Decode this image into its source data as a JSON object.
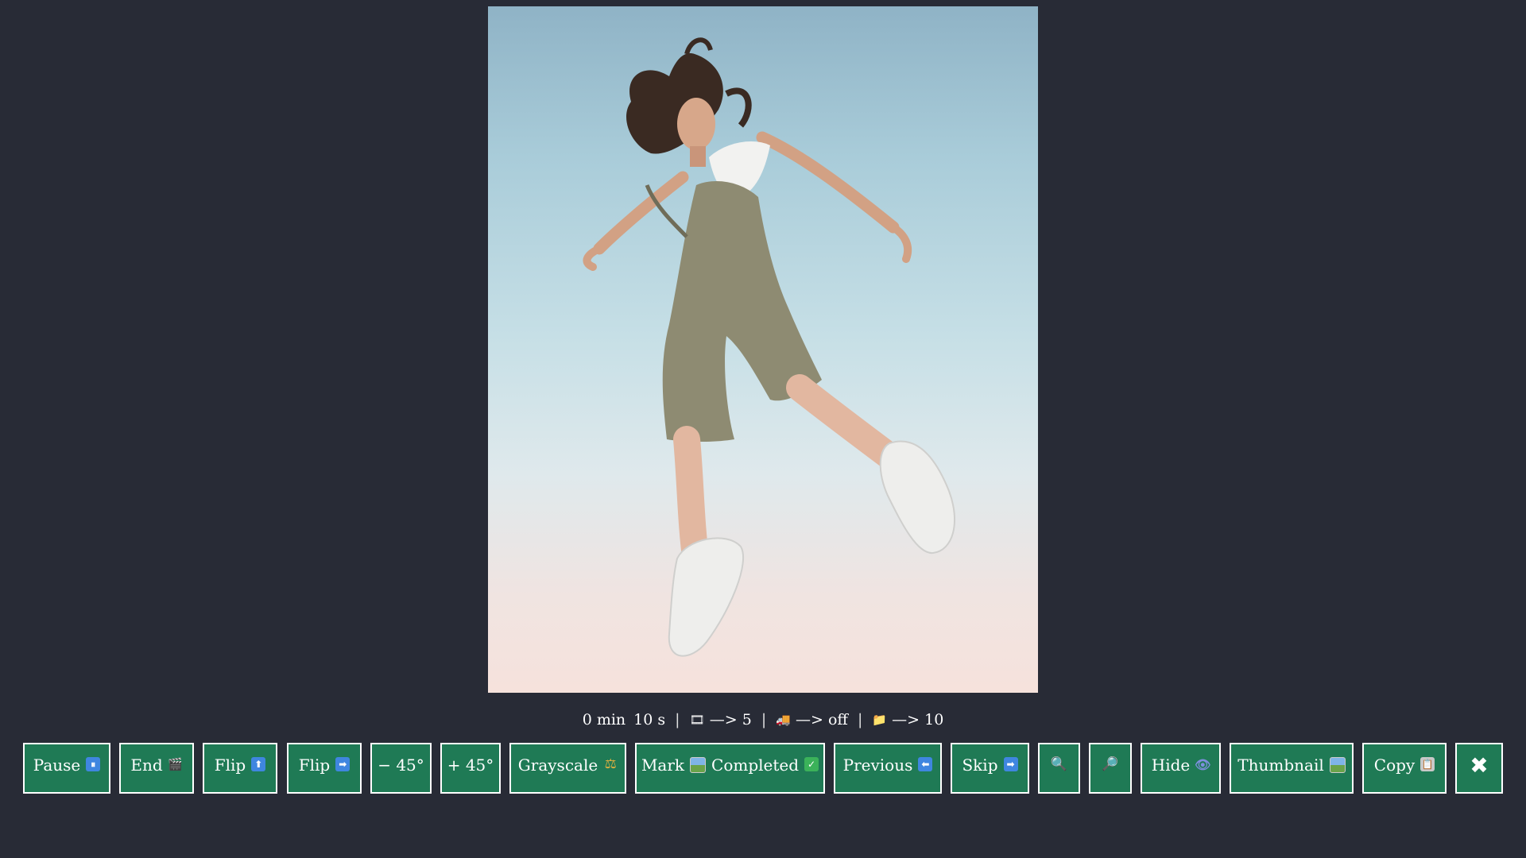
{
  "image": {
    "subject": "Woman jumping in overalls against sky",
    "sky_top_color": "#8fb3c6",
    "sky_bottom_color": "#f6e2dc"
  },
  "status": {
    "time_min": "0 min",
    "time_sec": "10 s",
    "sep": "|",
    "arrow": "—>",
    "slideshow_icon": "🎞",
    "slideshow_value": "5",
    "shuffle_icon": "🚚",
    "shuffle_value": "off",
    "folder_icon": "📁",
    "folder_value": "10"
  },
  "toolbar": {
    "pause_label": "Pause",
    "pause_icon": "⏸",
    "end_label": "End",
    "end_icon": "🎬",
    "flip_v_label": "Flip",
    "flip_v_icon": "⬆",
    "flip_h_label": "Flip",
    "flip_h_icon": "➡",
    "rotate_left_label": "− 45°",
    "rotate_right_label": "+ 45°",
    "grayscale_label": "Grayscale",
    "grayscale_icon": "⚖",
    "mark_label": "Mark",
    "mark_completed_label": "Completed",
    "mark_check_icon": "✓",
    "previous_label": "Previous",
    "previous_icon": "⬅",
    "skip_label": "Skip",
    "skip_icon": "➡",
    "zoom_in_icon": "🔍",
    "zoom_out_icon": "🔎",
    "hide_label": "Hide",
    "hide_icon": "👁",
    "thumbnail_label": "Thumbnail",
    "copy_label": "Copy",
    "copy_icon": "📋",
    "close_icon": "✖"
  },
  "colors": {
    "background": "#282b36",
    "button_bg": "#1f7a55",
    "button_border": "#ffffff",
    "text": "#ffffff"
  }
}
